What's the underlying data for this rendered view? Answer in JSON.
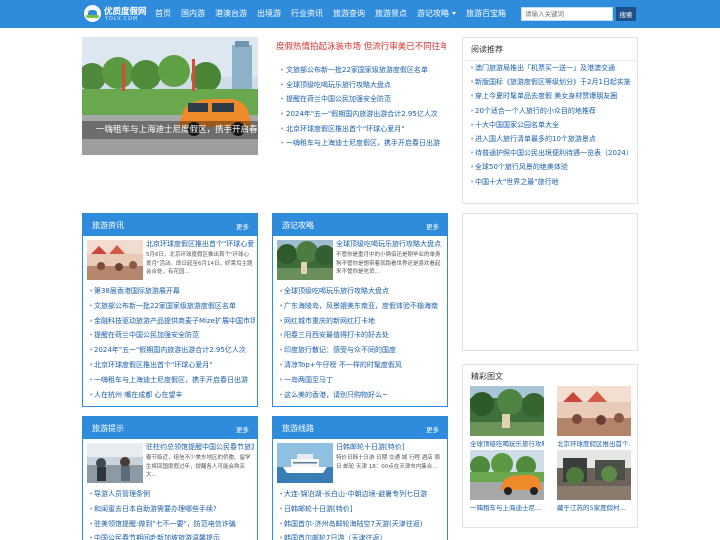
{
  "brand": {
    "name_cn": "优质度假网",
    "name_en": "YDLV.COM"
  },
  "colors": {
    "primary": "#2f8cdd",
    "search_button": "#1d4f8a",
    "headline": "#d32f2f",
    "link": "#1a5fa8"
  },
  "nav": {
    "items": [
      "首页",
      "国内游",
      "港澳台游",
      "出境游",
      "行业资讯",
      "旅游查询",
      "旅游景点",
      "游记攻略",
      "旅游百宝箱"
    ],
    "dropdown_item": "游记攻略"
  },
  "search": {
    "placeholder": "请输入关键词",
    "button": "搜索"
  },
  "slider": {
    "caption": "一嗨租车与上海迪士尼度假区，携手开启春日出游"
  },
  "headline": "度假热情拍起泳装市场 但流行审美已不同往年",
  "news": [
    "文旅部公布新一批22家国家级旅游度假区名单",
    "全球顶级吃喝玩乐旅行攻略大盘点",
    "提醒在荷兰中国公民加强安全防范",
    "2024年\"五一\"假期国内旅游出游合计2.95亿人次",
    "北京环球度假区推出首个\"环球心爱月\"",
    "一嗨租车与上海迪士尼度假区，携手开启春日出游"
  ],
  "reading": {
    "title": "阅读推荐",
    "items": [
      "澳门旅游局推出「机票买一送一」及港澳交通",
      "新版国标《旅游度假区等级划分》于2月1日起实施",
      "穿上今夏时髦单品去度假 美女身材赞爆朋友圈",
      "20个适合一个人旅行的小众目的地推荐",
      "十大中国国家公园名单大全",
      "进入国人旅行清单最多的10个旅游景点",
      "待普通护照中国公民出境便利待遇一览表（2024）",
      "全球50个旅行风景的绝美体验",
      "中国十大\"世界之最\"旅行地"
    ]
  },
  "panels": {
    "news": {
      "title": "旅游资讯",
      "more": "更多",
      "feature": {
        "title": "北京环球度假区推出首个\"环球心爱月\"",
        "text": "5月6日，北京环球度假区推出首个\"环球心爱月\"活动。即日起至6月14日，好莱坞主题会合处，有花园..."
      },
      "items": [
        "第38届香港国际旅游展开幕",
        "文旅部公布新一批22家国家级旅游度假区名单",
        "金融科技驱动旅游产品提供商麦子Mize扩展中国市场",
        "提醒在荷兰中国公民加强安全防范",
        "2024年\"五一\"假期国内旅游出游合计2.95亿人次",
        "北京环球度假区推出首个\"环球心爱月\"",
        "一嗨租车与上海迪士尼度假区，携手开启春日出游",
        "人在杭州 嘴在成都 心在望丰"
      ]
    },
    "guides": {
      "title": "游记攻略",
      "more": "更多",
      "feature": {
        "title": "全球顶级吃喝玩乐旅行攻略大盘点",
        "text": "不管你是重月中的小俩侣还是刚毕业的单身狗不管你是想带着就跑看世界还是喜欢看起来不管你是吃货..."
      },
      "items": [
        "全球顶级吃喝玩乐旅行攻略大盘点",
        "广东海陵岛，风景媲美东南亚，度假体验不输海南",
        "网红城市重庆的新网红打卡地",
        "阳春三月西安最值得打卡的好去处",
        "印度旅行散记：感受与众不同的国度",
        "清凉Top+午仔榜 不一样的时髦度假风",
        "一岛两国至马丁",
        "这么美的香港，请别只购物好么~"
      ]
    },
    "tips": {
      "title": "旅游提示",
      "more": "更多",
      "feature": {
        "title": "驻柱约总领馆提醒中国公民春节旅游",
        "text": "春节临近，组信不少美东地区的侨胞、留学生将回国度假过年，提醒各人可能会购买大..."
      },
      "items": [
        "导游人员管理条例",
        "和闺蜜去日本自助游需要办理哪些手续?",
        "驻美领馆提醒:做到\"七不一要\"，防范电信诈骗",
        "中国公民春节期间赴新加坡旅游温馨提示"
      ]
    },
    "routes": {
      "title": "旅游线路",
      "more": "更多",
      "feature": {
        "title": "日韩邮轮十日游[特价]",
        "text": "特价日韩十日游 日期 交通 城 行程 酒店 周日 邮轮 天津 18：00点在天津市内集合..."
      },
      "items": [
        "大连-锦泊湖-长白山-中朝边境-避暑专列七日游",
        "日韩邮轮十日游[特价]",
        "韩国首尔-济州岛邮轮海陆空7天游(天津往返)",
        "韩国首尔邮轮7日游（天津往返）"
      ]
    }
  },
  "gallery": {
    "title": "精彩图文",
    "items": [
      "全球顶级吃喝玩乐旅行攻略...",
      "北京环球度假区推出首个...",
      "一嗨租车与上海迪士尼...",
      "藏于江苏的5家度假村..."
    ]
  }
}
